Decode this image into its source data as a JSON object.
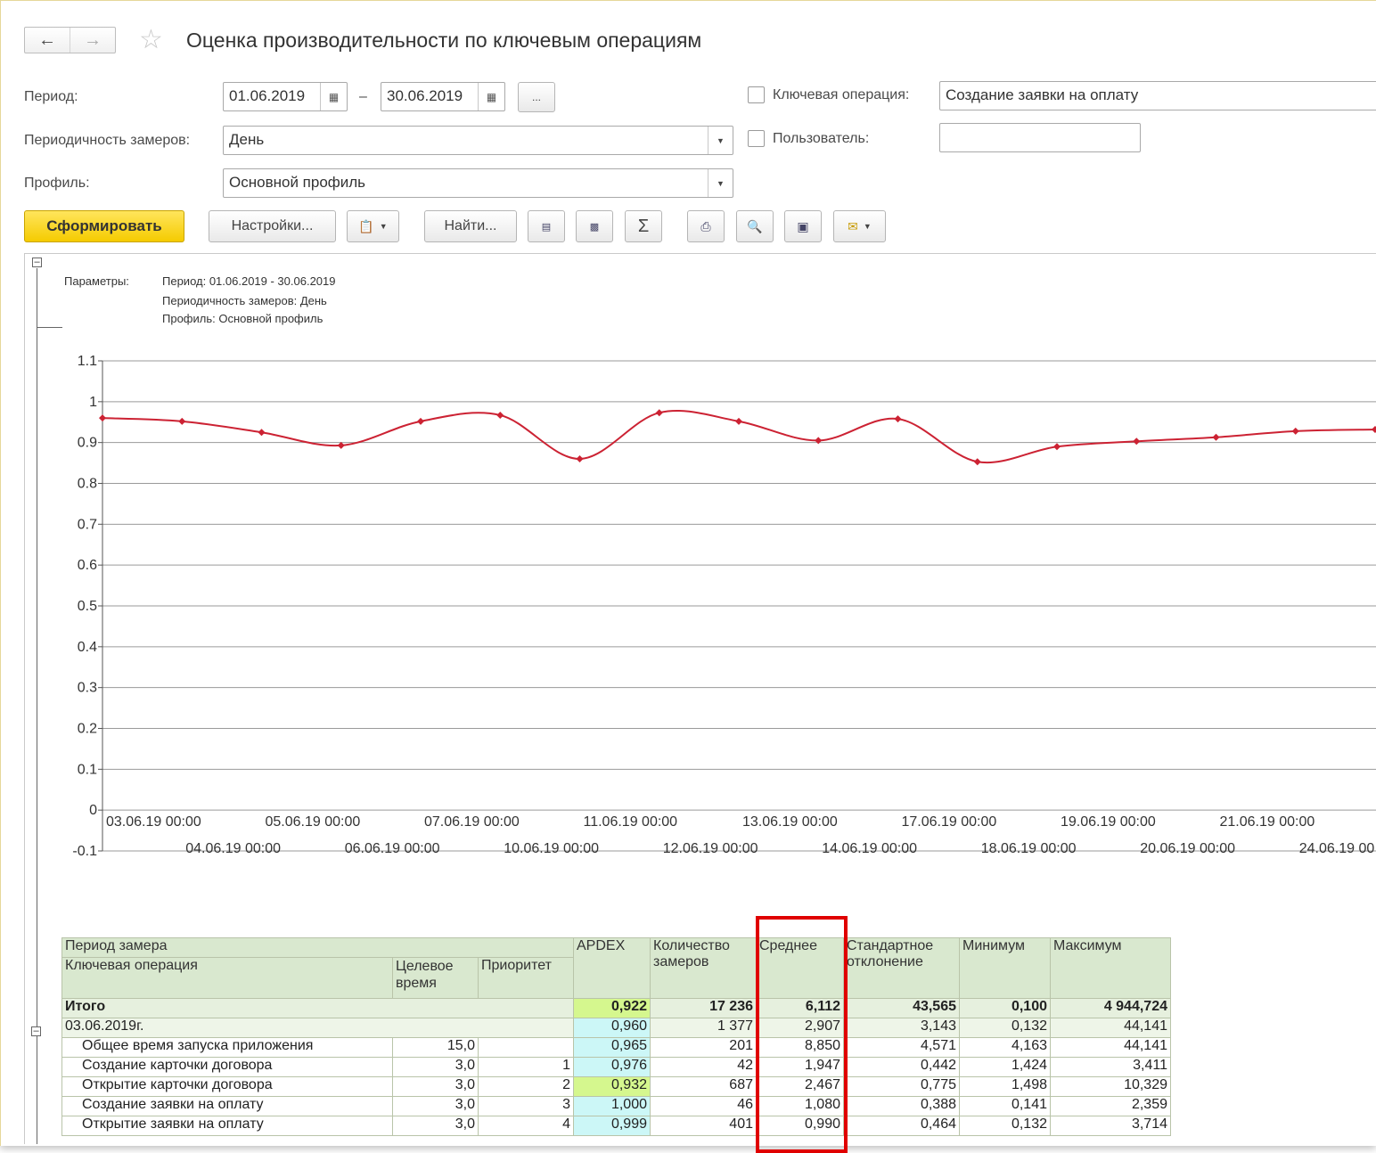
{
  "header": {
    "back_icon": "arrow-left-icon",
    "forward_icon": "arrow-right-icon",
    "favorite_icon": "star-icon",
    "title": "Оценка производительности по ключевым операциям"
  },
  "form": {
    "period_label": "Период:",
    "date_from": "01.06.2019",
    "dash": "–",
    "date_to": "30.06.2019",
    "period_btn": "...",
    "key_operation_label": "Ключевая операция:",
    "key_operation_value": "Создание заявки на оплату",
    "frequency_label": "Периодичность замеров:",
    "frequency_value": "День",
    "user_label": "Пользователь:",
    "user_value": "",
    "profile_label": "Профиль:",
    "profile_value": "Основной профиль"
  },
  "toolbar": {
    "generate": "Сформировать",
    "settings": "Настройки...",
    "find": "Найти...",
    "sum_icon": "Σ"
  },
  "params": {
    "label": "Параметры:",
    "line1": "Период: 01.06.2019 - 30.06.2019",
    "line2": "Периодичность замеров: День",
    "line3": "Профиль: Основной профиль"
  },
  "chart_data": {
    "type": "line",
    "y_ticks": [
      "1.1",
      "1",
      "0.9",
      "0.8",
      "0.7",
      "0.6",
      "0.5",
      "0.4",
      "0.3",
      "0.2",
      "0.1",
      "0",
      "-0.1"
    ],
    "ylim": [
      -0.1,
      1.1
    ],
    "x_labels_top": [
      "03.06.19 00:00",
      "05.06.19 00:00",
      "07.06.19 00:00",
      "11.06.19 00:00",
      "13.06.19 00:00",
      "17.06.19 00:00",
      "19.06.19 00:00",
      "21.06.19 00:00"
    ],
    "x_labels_bottom": [
      "04.06.19 00:00",
      "06.06.19 00:00",
      "10.06.19 00:00",
      "12.06.19 00:00",
      "14.06.19 00:00",
      "18.06.19 00:00",
      "20.06.19 00:00",
      "24.06.19 00"
    ],
    "x": [
      "03.06.19 00:00",
      "04.06.19 00:00",
      "05.06.19 00:00",
      "06.06.19 00:00",
      "07.06.19 00:00",
      "10.06.19 00:00",
      "11.06.19 00:00",
      "12.06.19 00:00",
      "13.06.19 00:00",
      "14.06.19 00:00",
      "17.06.19 00:00",
      "18.06.19 00:00",
      "19.06.19 00:00",
      "20.06.19 00:00",
      "21.06.19 00:00",
      "24.06.19 00"
    ],
    "values": [
      0.96,
      0.952,
      0.925,
      0.893,
      0.952,
      0.967,
      0.86,
      0.973,
      0.952,
      0.905,
      0.958,
      0.853,
      0.89,
      0.903,
      0.913,
      0.928,
      0.932
    ],
    "color": "#cc2233",
    "grid": true
  },
  "table": {
    "headers": {
      "period": "Период замера",
      "operation": "Ключевая операция",
      "target_time": "Целевое время",
      "priority": "Приоритет",
      "apdex": "APDEX",
      "count": "Количество замеров",
      "avg": "Среднее",
      "stddev": "Стандартное отклонение",
      "min": "Минимум",
      "max": "Максимум"
    },
    "total": {
      "label": "Итого",
      "apdex": "0,922",
      "count": "17 236",
      "avg": "6,112",
      "stddev": "43,565",
      "min": "0,100",
      "max": "4 944,724"
    },
    "group": {
      "label": "03.06.2019г.",
      "apdex": "0,960",
      "count": "1 377",
      "avg": "2,907",
      "stddev": "3,143",
      "min": "0,132",
      "max": "44,141"
    },
    "rows": [
      {
        "name": "Общее время запуска приложения",
        "target": "15,0",
        "priority": "",
        "apdex": "0,965",
        "count": "201",
        "avg": "8,850",
        "stddev": "4,571",
        "min": "4,163",
        "max": "44,141"
      },
      {
        "name": "Создание карточки договора",
        "target": "3,0",
        "priority": "1",
        "apdex": "0,976",
        "count": "42",
        "avg": "1,947",
        "stddev": "0,442",
        "min": "1,424",
        "max": "3,411"
      },
      {
        "name": "Открытие карточки договора",
        "target": "3,0",
        "priority": "2",
        "apdex": "0,932",
        "count": "687",
        "avg": "2,467",
        "stddev": "0,775",
        "min": "1,498",
        "max": "10,329"
      },
      {
        "name": "Создание заявки на оплату",
        "target": "3,0",
        "priority": "3",
        "apdex": "1,000",
        "count": "46",
        "avg": "1,080",
        "stddev": "0,388",
        "min": "0,141",
        "max": "2,359"
      },
      {
        "name": "Открытие заявки на оплату",
        "target": "3,0",
        "priority": "4",
        "apdex": "0,999",
        "count": "401",
        "avg": "0,990",
        "stddev": "0,464",
        "min": "0,132",
        "max": "3,714"
      }
    ]
  }
}
